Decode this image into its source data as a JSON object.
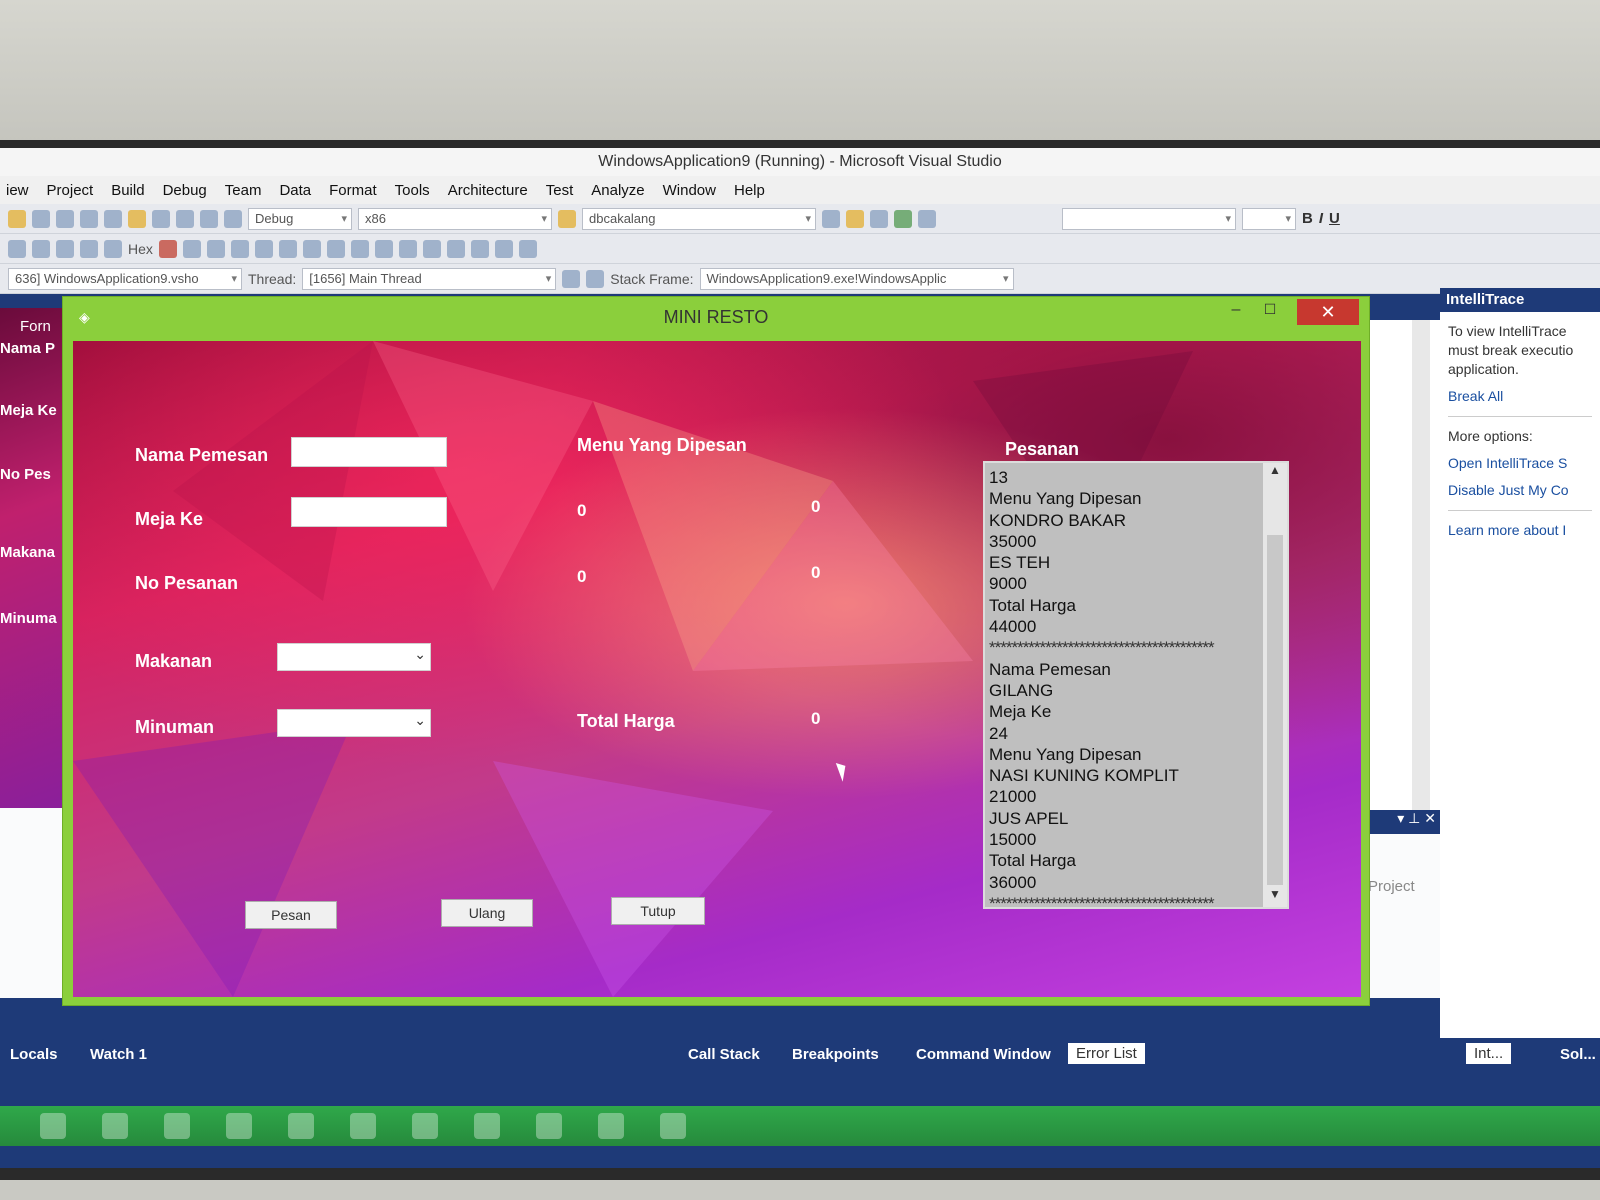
{
  "vs": {
    "title": "WindowsApplication9 (Running) - Microsoft Visual Studio",
    "menu": [
      "iew",
      "Project",
      "Build",
      "Debug",
      "Team",
      "Data",
      "Format",
      "Tools",
      "Architecture",
      "Test",
      "Analyze",
      "Window",
      "Help"
    ],
    "config_combo": "Debug",
    "platform_combo": "x86",
    "find_combo": "dbcakalang",
    "process_combo": "636] WindowsApplication9.vsho",
    "thread_label": "Thread:",
    "thread_combo": "[1656] Main Thread",
    "stackframe_label": "Stack Frame:",
    "stackframe_combo": "WindowsApplication9.exe!WindowsApplic",
    "hex_label": "Hex"
  },
  "left_form": {
    "tab": "Forn",
    "labels": [
      "Nama P",
      "Meja Ke",
      "No Pes",
      "Makana",
      "Minuma"
    ]
  },
  "intellitrace": {
    "title": "IntelliTrace",
    "message": "To view IntelliTrace must break executio application.",
    "break_all": "Break All",
    "more_options": "More options:",
    "open_settings": "Open IntelliTrace S",
    "disable_jmc": "Disable Just My Co",
    "learn_more": "Learn more about I"
  },
  "right_pane": {
    "project": "Project"
  },
  "bottom_tabs": {
    "locals": "Locals",
    "watch": "Watch 1",
    "call_stack": "Call Stack",
    "breakpoints": "Breakpoints",
    "command_window": "Command Window",
    "error_list": "Error List",
    "int": "Int...",
    "sol": "Sol..."
  },
  "form": {
    "title": "MINI RESTO",
    "labels": {
      "nama_pemesan": "Nama Pemesan",
      "meja_ke": "Meja Ke",
      "no_pesanan": "No Pesanan",
      "makanan": "Makanan",
      "minuman": "Minuman",
      "menu_yang_dipesan": "Menu Yang Dipesan",
      "total_harga": "Total Harga",
      "pesanan": "Pesanan"
    },
    "inputs": {
      "nama_pemesan": "",
      "meja_ke": "",
      "makanan": "",
      "minuman": ""
    },
    "values": {
      "menu1_left": "0",
      "menu1_right": "0",
      "menu2_left": "0",
      "menu2_right": "0",
      "total": "0"
    },
    "buttons": {
      "pesan": "Pesan",
      "ulang": "Ulang",
      "tutup": "Tutup"
    },
    "list_items": [
      "13",
      "Menu Yang Dipesan",
      "KONDRO BAKAR",
      "35000",
      "ES TEH",
      "9000",
      "Total Harga",
      "44000",
      "****************************************",
      "Nama Pemesan",
      "GILANG",
      "Meja Ke",
      "24",
      "Menu Yang Dipesan",
      "NASI KUNING KOMPLIT",
      "21000",
      "JUS APEL",
      "15000",
      "Total Harga",
      "36000",
      "****************************************"
    ]
  }
}
